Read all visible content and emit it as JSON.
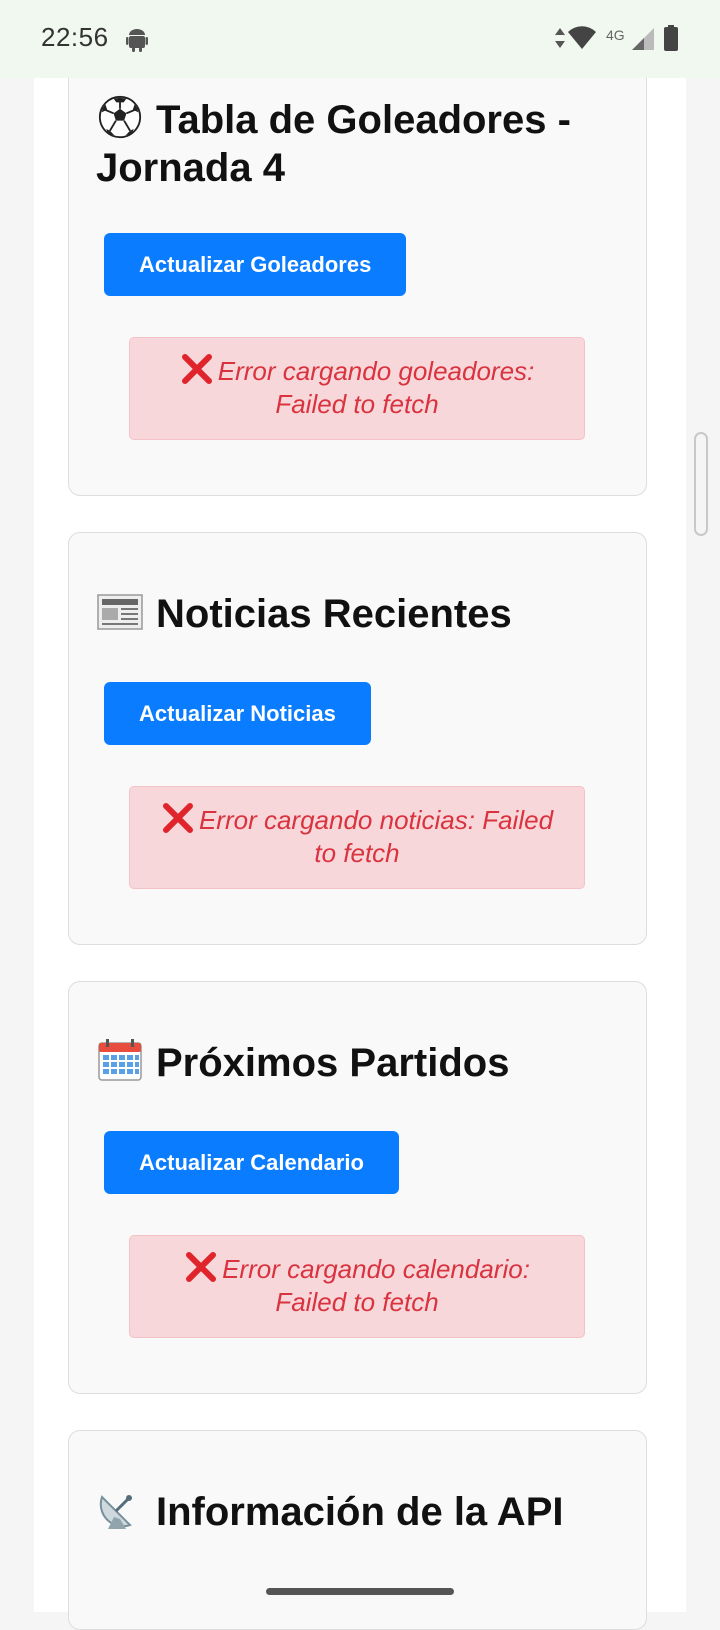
{
  "status_bar": {
    "time": "22:56",
    "network_type": "4G",
    "icons": [
      "android-icon",
      "data-arrows-icon",
      "wifi-icon",
      "signal-icon",
      "battery-icon"
    ]
  },
  "colors": {
    "button": "#0a7cff",
    "error_bg": "#f8d7da",
    "error_text": "#d9333f",
    "card_bg": "#f9f9f9"
  },
  "sections": [
    {
      "icon": "soccer-ball-icon",
      "title": "Tabla de Goleadores - Jornada 4",
      "button_label": "Actualizar Goleadores",
      "error_text": "Error cargando goleadores: Failed to fetch"
    },
    {
      "icon": "newspaper-icon",
      "title": "Noticias Recientes",
      "button_label": "Actualizar Noticias",
      "error_text": "Error cargando noticias: Failed to fetch"
    },
    {
      "icon": "calendar-icon",
      "title": "Próximos Partidos",
      "button_label": "Actualizar Calendario",
      "error_text": "Error cargando calendario: Failed to fetch"
    },
    {
      "icon": "satellite-dish-icon",
      "title": "Información de la API"
    }
  ]
}
